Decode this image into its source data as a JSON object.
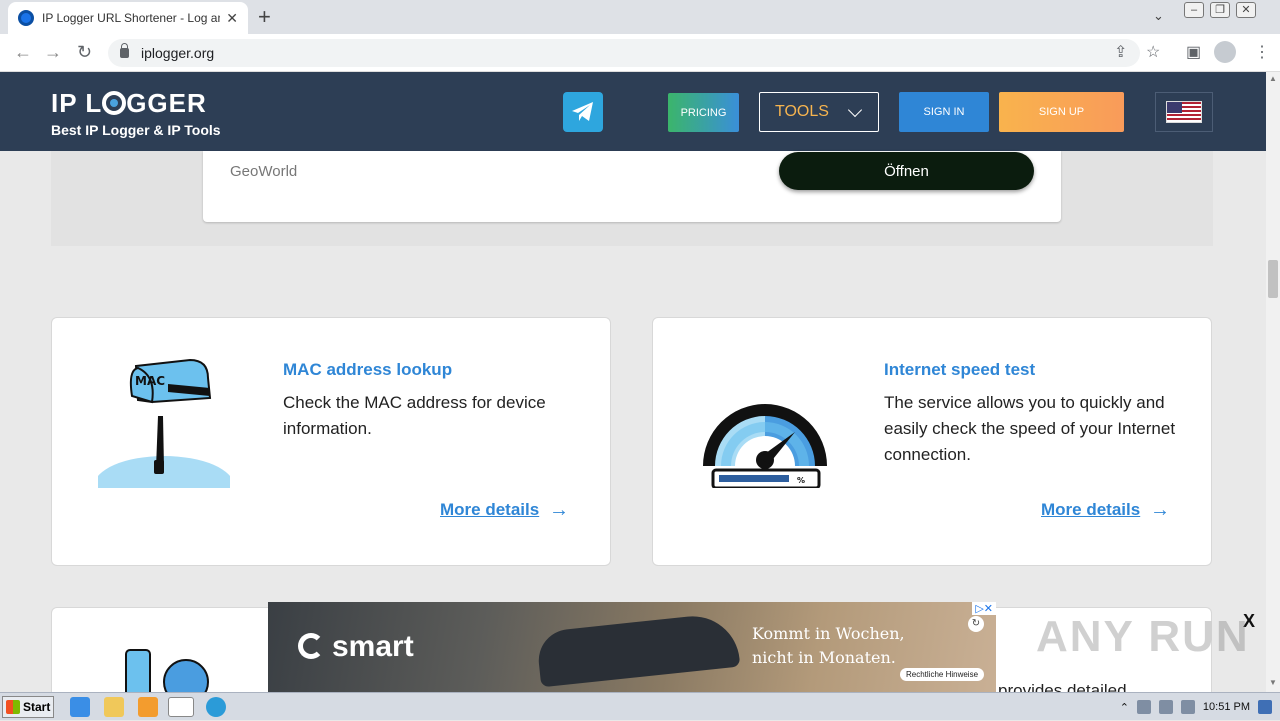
{
  "browser": {
    "tab_title": "IP Logger URL Shortener - Log and T",
    "url": "iplogger.org",
    "tab_close": "✕",
    "new_tab": "+"
  },
  "header": {
    "logo_text_1": "IP L",
    "logo_text_2": "GGER",
    "tagline": "Best IP Logger & IP Tools",
    "pricing": "PRICING",
    "tools": "TOOLS",
    "sign_in": "SIGN IN",
    "sign_up": "SIGN UP"
  },
  "ad_top": {
    "brand": "GeoWorld",
    "cta": "Öffnen"
  },
  "cards": [
    {
      "title": "MAC address lookup",
      "desc": "Check the MAC address for device information.",
      "more": "More details"
    },
    {
      "title": "Internet speed test",
      "desc": "The service allows you to quickly and easily check the speed of your Internet connection.",
      "more": "More details"
    }
  ],
  "card4_partial": "provides detailed",
  "banner": {
    "brand": "smart",
    "slogan_1": "Kommt in Wochen,",
    "slogan_2": "nicht in Monaten.",
    "hinweise": "Rechtliche Hinweise",
    "close": "X"
  },
  "watermark": "ANY RUN",
  "taskbar": {
    "start": "Start",
    "time": "10:51 PM"
  },
  "colors": {
    "header_bg": "#2d3e55",
    "accent_blue": "#2f86d6",
    "tools_orange": "#f6b44f"
  }
}
